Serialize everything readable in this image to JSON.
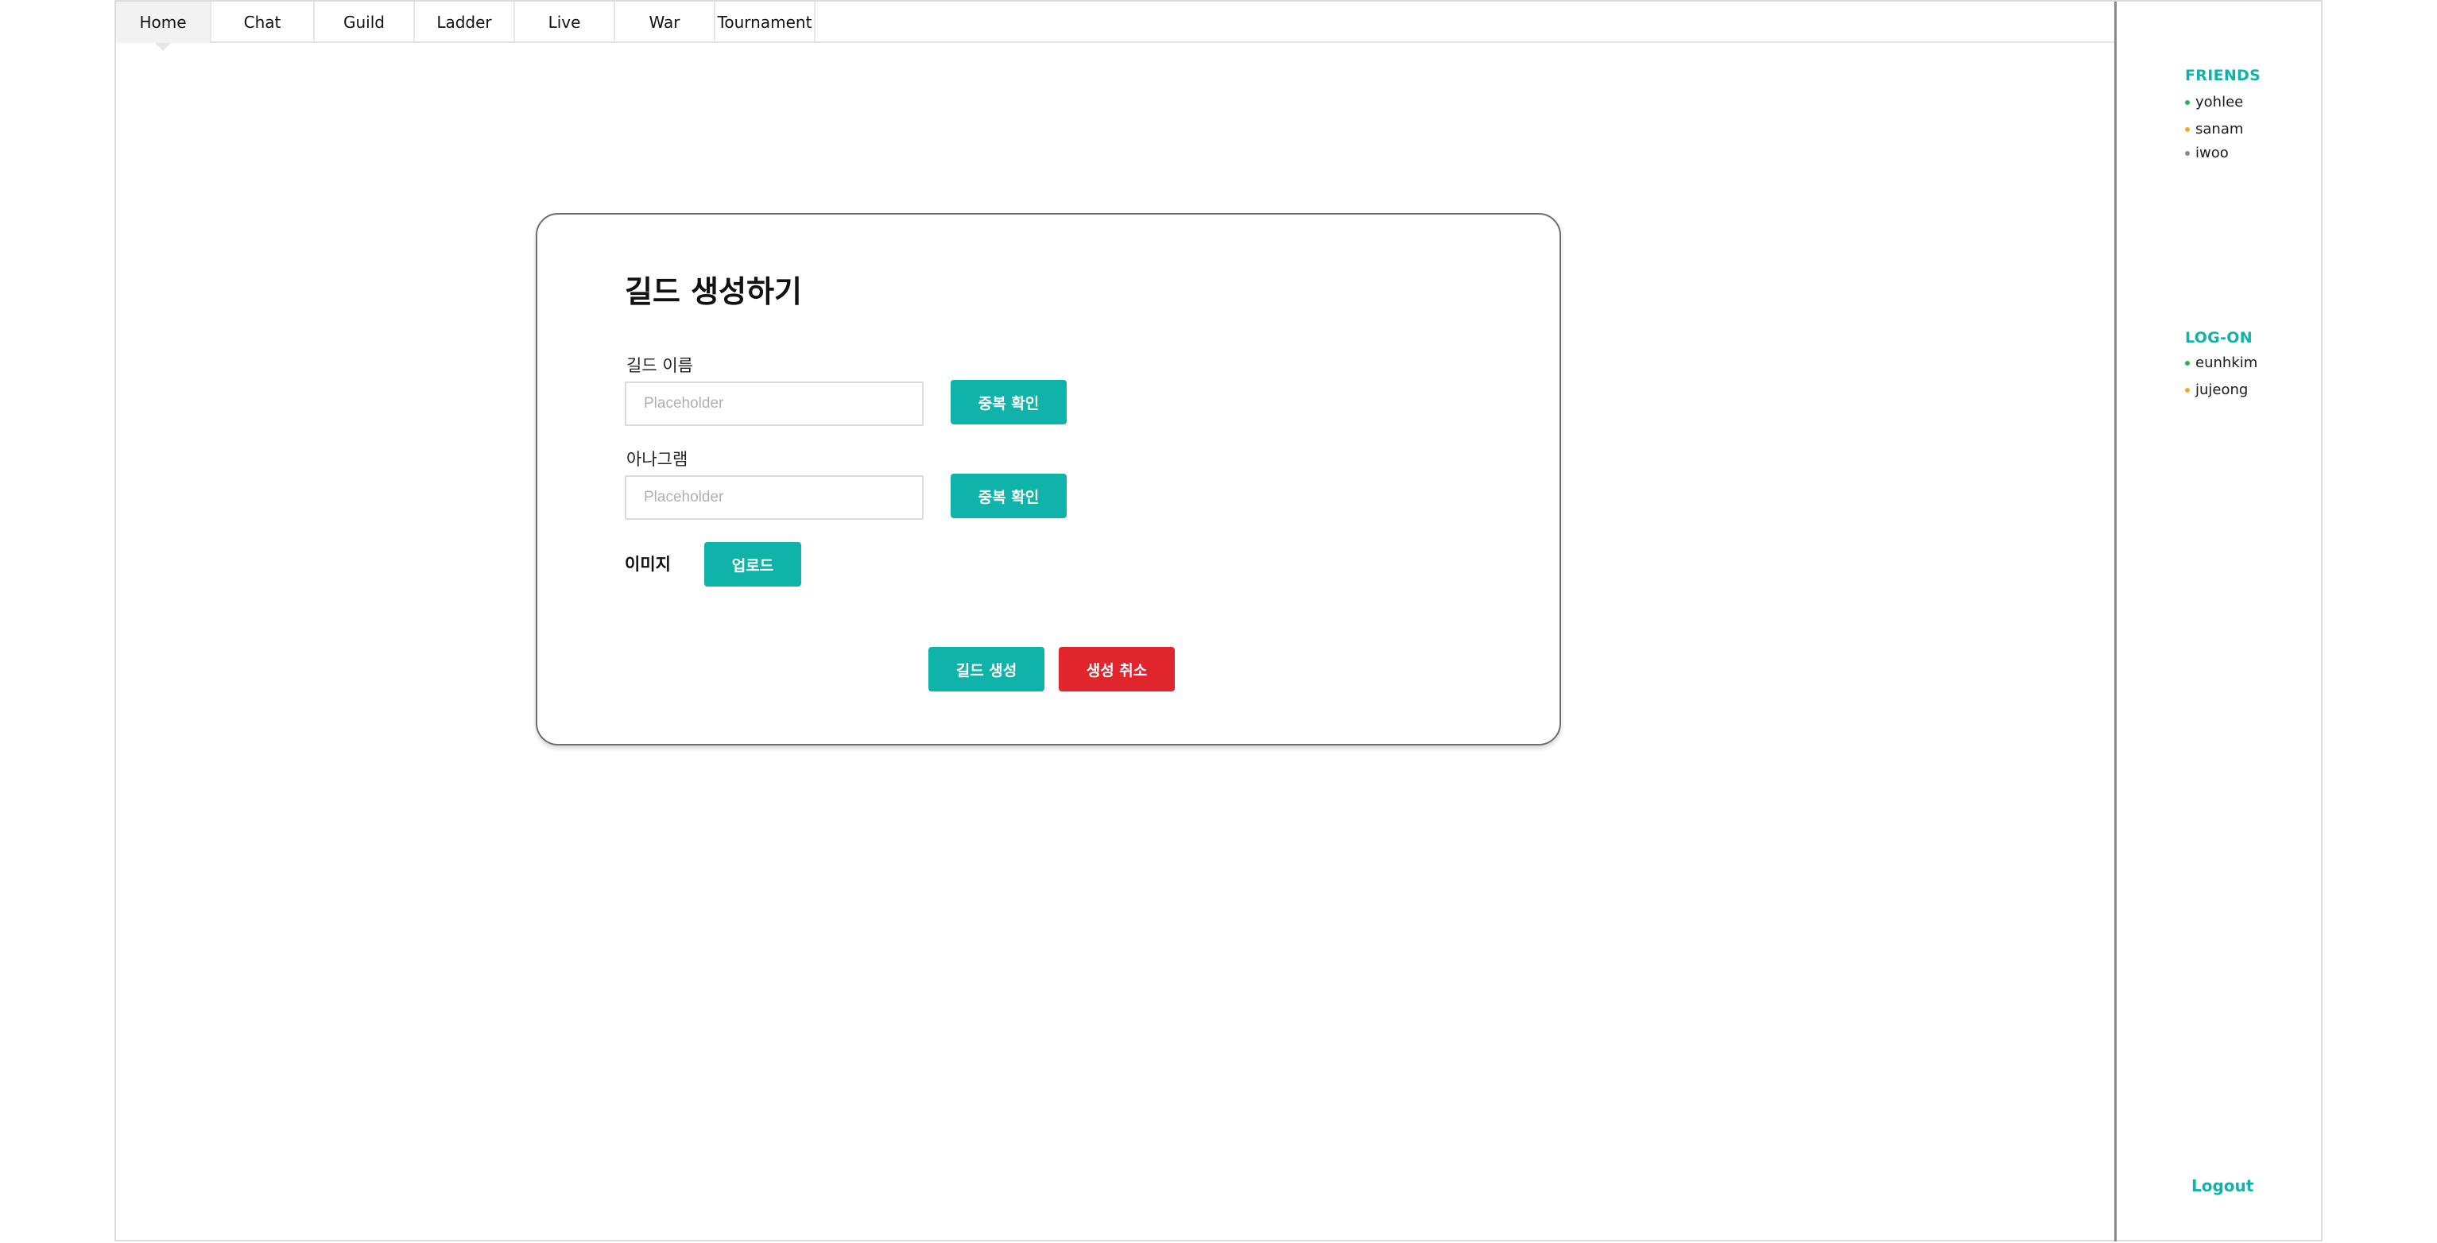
{
  "nav": {
    "tabs": [
      {
        "label": "Home",
        "active": true
      },
      {
        "label": "Chat",
        "active": false
      },
      {
        "label": "Guild",
        "active": false
      },
      {
        "label": "Ladder",
        "active": false
      },
      {
        "label": "Live",
        "active": false
      },
      {
        "label": "War",
        "active": false
      },
      {
        "label": "Tournament",
        "active": false
      }
    ]
  },
  "dialog": {
    "title": "길드 생성하기",
    "guild_name": {
      "label": "길드 이름",
      "placeholder": "Placeholder",
      "value": "",
      "check_button": "중복 확인"
    },
    "anagram": {
      "label": "아나그램",
      "placeholder": "Placeholder",
      "value": "",
      "check_button": "중복 확인"
    },
    "image": {
      "label": "이미지",
      "upload_button": "업로드"
    },
    "create_button": "길드 생성",
    "cancel_button": "생성 취소"
  },
  "sidebar": {
    "friends": {
      "heading": "FRIENDS",
      "users": [
        {
          "name": "yohlee",
          "status_color": "#2bb24c"
        },
        {
          "name": "sanam",
          "status_color": "#f5a623"
        },
        {
          "name": "iwoo",
          "status_color": "#8a8a8a"
        }
      ]
    },
    "logon": {
      "heading": "LOG-ON",
      "users": [
        {
          "name": "eunhkim",
          "status_color": "#2bb24c"
        },
        {
          "name": "jujeong",
          "status_color": "#f5a623"
        }
      ]
    },
    "logout_label": "Logout"
  },
  "colors": {
    "accent": "#0fb3aa",
    "danger": "#e0262c"
  }
}
